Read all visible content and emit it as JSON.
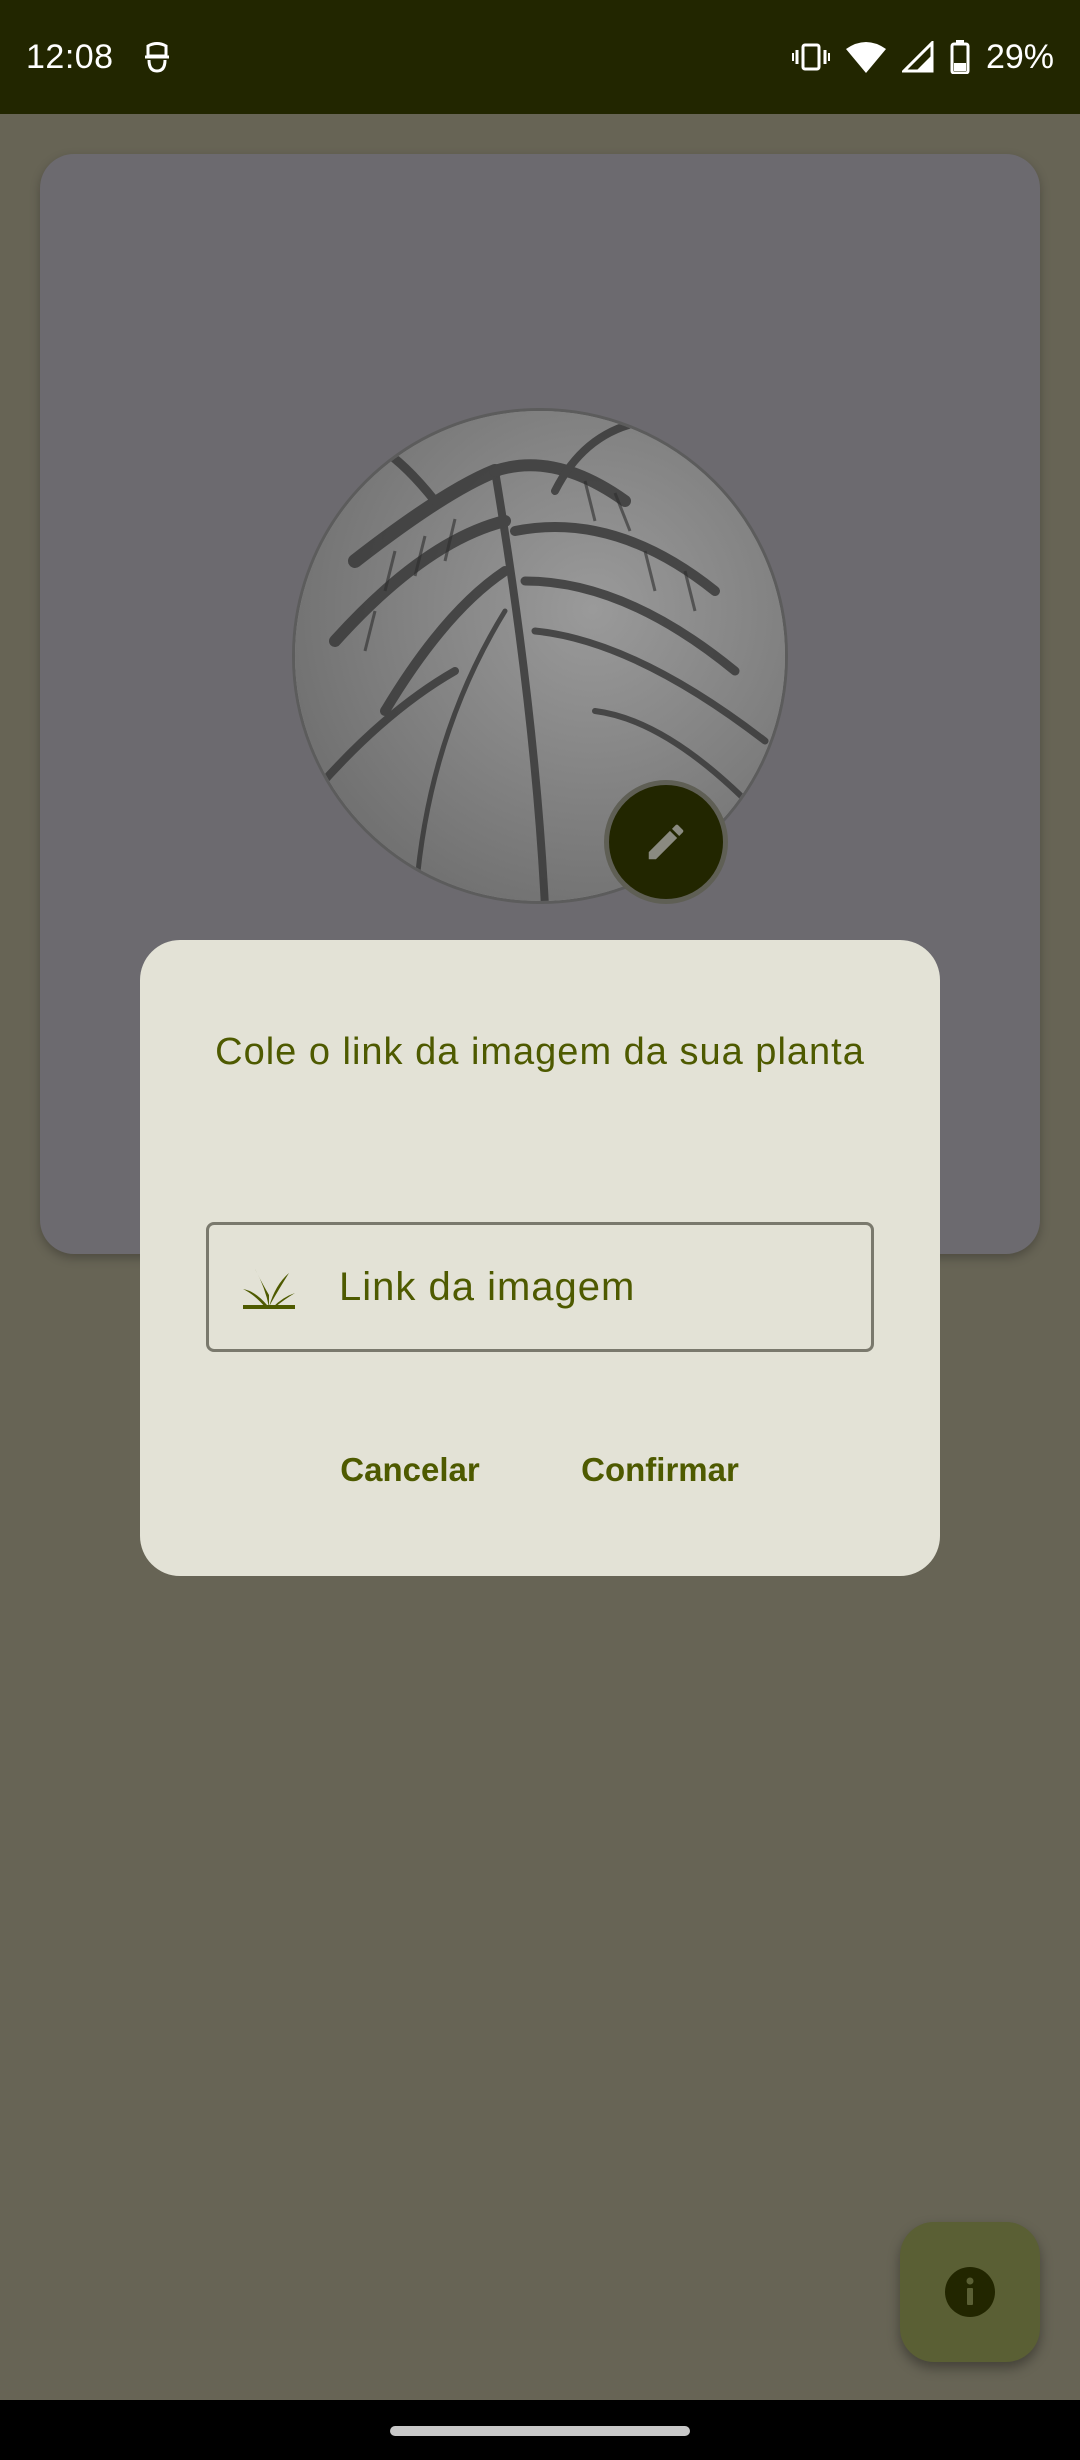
{
  "status_bar": {
    "time": "12:08",
    "battery": "29%",
    "icons": [
      "privacy-icon",
      "vibrate-icon",
      "wifi-icon",
      "signal-icon",
      "battery-icon"
    ]
  },
  "dialog": {
    "title": "Cole o link da imagem da sua planta",
    "input": {
      "placeholder": "Link da imagem",
      "value": "",
      "icon": "leaf-icon"
    },
    "cancel_label": "Cancelar",
    "confirm_label": "Confirmar"
  },
  "card": {
    "image": "plant-photo",
    "edit_icon": "pencil-icon"
  },
  "fab": {
    "icon": "info-icon"
  },
  "colors": {
    "status_bar": "#222600",
    "scrim_background": "#676455",
    "dialog_background": "#e3e2d6",
    "accent_text": "#4e5a00",
    "fab": "#5a5f34"
  }
}
